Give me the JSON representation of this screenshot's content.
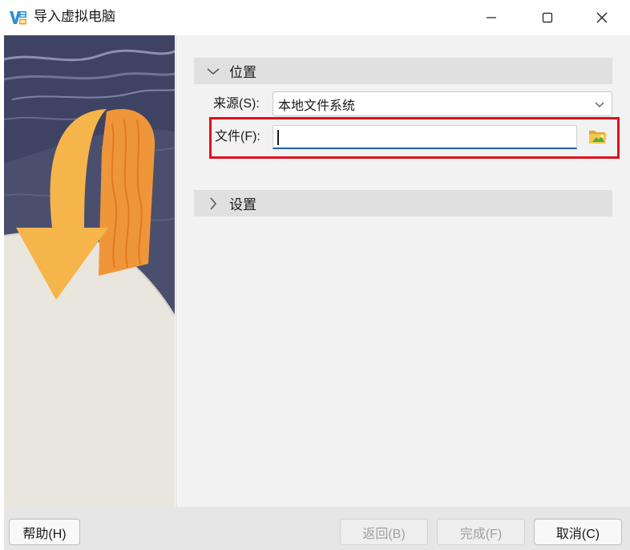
{
  "window": {
    "title": "导入虚拟电脑",
    "app_icon": "virtualbox-icon",
    "controls": [
      "minimize-icon",
      "maximize-icon",
      "close-icon"
    ]
  },
  "sections": {
    "location": {
      "label": "位置",
      "expanded": true
    },
    "settings": {
      "label": "设置",
      "expanded": false
    }
  },
  "source": {
    "label": "来源(S):",
    "value": "本地文件系统"
  },
  "file": {
    "label": "文件(F):",
    "value": "",
    "browse_icon": "folder-open-icon"
  },
  "footer": {
    "help": "帮助(H)",
    "back": "返回(B)",
    "finish": "完成(F)",
    "cancel": "取消(C)"
  },
  "colors": {
    "highlight": "#e0101a",
    "input_focus": "#1f5fa8",
    "section_bg": "#e0e0e0"
  }
}
